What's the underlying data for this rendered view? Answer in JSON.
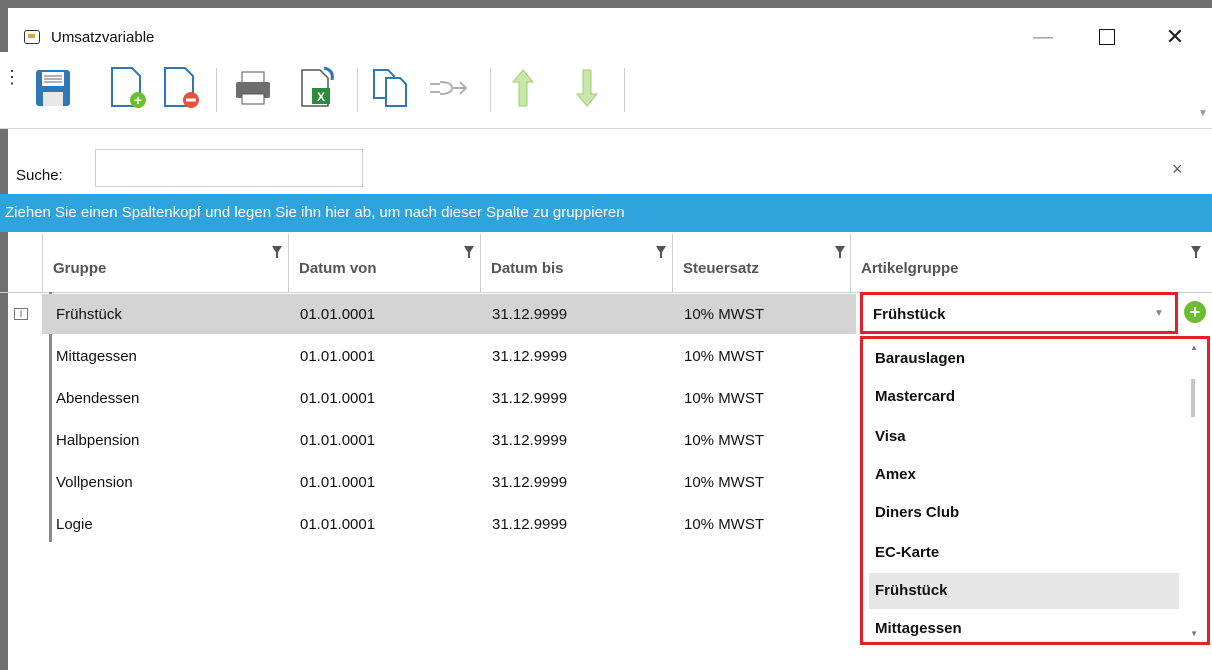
{
  "window": {
    "title": "Umsatzvariable"
  },
  "toolbar": {
    "buttons": [
      {
        "name": "save"
      },
      {
        "name": "add-row"
      },
      {
        "name": "delete-row"
      },
      {
        "name": "print"
      },
      {
        "name": "export-excel"
      },
      {
        "name": "copy"
      },
      {
        "name": "link"
      },
      {
        "name": "move-up"
      },
      {
        "name": "move-down"
      }
    ]
  },
  "search": {
    "label": "Suche:",
    "value": "",
    "clear_icon": "×"
  },
  "group_panel": {
    "text": "Ziehen Sie einen Spaltenkopf und legen Sie ihn hier ab, um nach dieser Spalte zu gruppieren"
  },
  "grid": {
    "columns": [
      "Gruppe",
      "Datum von",
      "Datum bis",
      "Steuersatz",
      "Artikelgruppe"
    ],
    "rows": [
      {
        "gruppe": "Frühstück",
        "datum_von": "01.01.0001",
        "datum_bis": "31.12.9999",
        "steuersatz": "10% MWST",
        "artikelgruppe": "Frühstück"
      },
      {
        "gruppe": "Mittagessen",
        "datum_von": "01.01.0001",
        "datum_bis": "31.12.9999",
        "steuersatz": "10% MWST",
        "artikelgruppe": ""
      },
      {
        "gruppe": "Abendessen",
        "datum_von": "01.01.0001",
        "datum_bis": "31.12.9999",
        "steuersatz": "10% MWST",
        "artikelgruppe": ""
      },
      {
        "gruppe": "Halbpension",
        "datum_von": "01.01.0001",
        "datum_bis": "31.12.9999",
        "steuersatz": "10% MWST",
        "artikelgruppe": ""
      },
      {
        "gruppe": "Vollpension",
        "datum_von": "01.01.0001",
        "datum_bis": "31.12.9999",
        "steuersatz": "10% MWST",
        "artikelgruppe": ""
      },
      {
        "gruppe": "Logie",
        "datum_von": "01.01.0001",
        "datum_bis": "31.12.9999",
        "steuersatz": "10% MWST",
        "artikelgruppe": ""
      }
    ]
  },
  "combo": {
    "selected": "Frühstück",
    "options": [
      "Barauslagen",
      "Mastercard",
      "Visa",
      "Amex",
      "Diners Club",
      "EC-Karte",
      "Frühstück",
      "Mittagessen"
    ],
    "hovered": "Frühstück"
  },
  "colors": {
    "accent": "#2fa4dc",
    "highlight": "#e32128",
    "selected_row": "#d4d4d4"
  }
}
